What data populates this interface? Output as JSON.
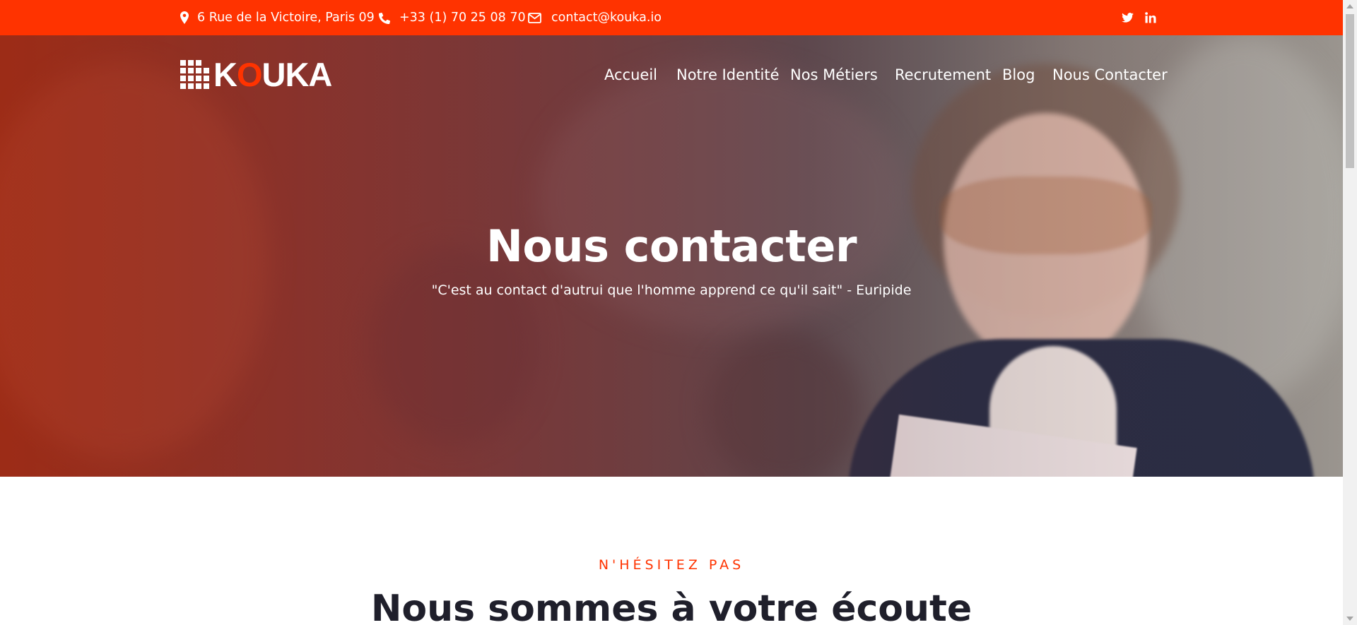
{
  "topbar": {
    "address": "6 Rue de la Victoire, Paris 09",
    "phone": "+33 (1) 70 25 08 70",
    "email": "contact@kouka.io",
    "icons": {
      "address": "map-marker-icon",
      "phone": "phone-icon",
      "email": "envelope-icon",
      "twitter": "twitter-icon",
      "linkedin": "linkedin-icon"
    }
  },
  "brand": {
    "name_prefix": "K",
    "name_o": "O",
    "name_suffix": "UKA",
    "accent_color": "#ff3300"
  },
  "nav": {
    "items": [
      {
        "label": "Accueil"
      },
      {
        "label": "Notre Identité"
      },
      {
        "label": "Nos Métiers"
      },
      {
        "label": "Recrutement"
      },
      {
        "label": "Blog"
      },
      {
        "label": "Nous Contacter"
      }
    ]
  },
  "hero": {
    "title": "Nous contacter",
    "quote": "\"C'est au contact d'autrui que l'homme apprend ce qu'il sait\" - Euripide"
  },
  "section": {
    "kicker": "N'HÉSITEZ PAS",
    "title": "Nous sommes à votre écoute"
  },
  "colors": {
    "topbar": "#ff3300",
    "heading": "#1f1f2b"
  }
}
